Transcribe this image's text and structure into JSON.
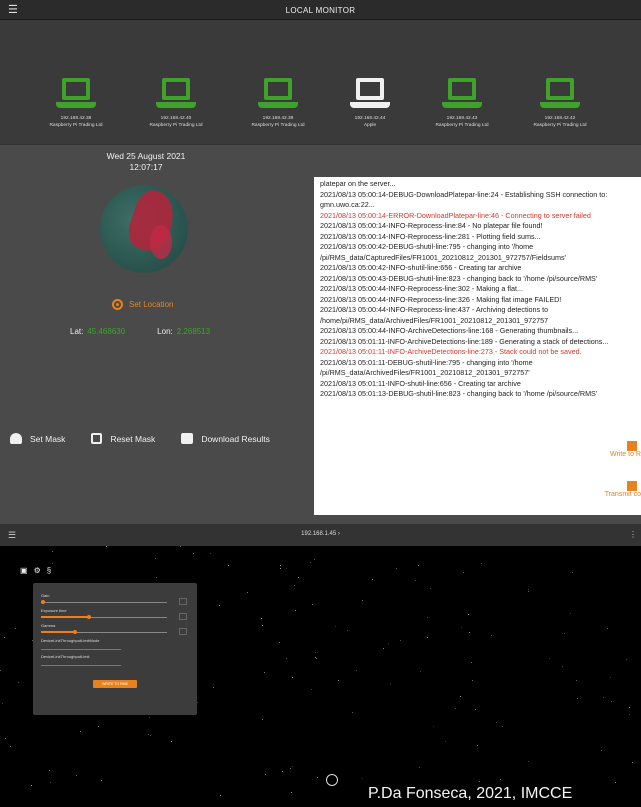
{
  "app": {
    "title": "LOCAL MONITOR"
  },
  "devices": [
    {
      "ip": "192.168.42.38",
      "vendor": "Raspberry Pi Trading Ltd",
      "color": "#3fa32b"
    },
    {
      "ip": "192.168.42.40",
      "vendor": "Raspberry Pi Trading Ltd",
      "color": "#3fa32b"
    },
    {
      "ip": "192.168.42.39",
      "vendor": "Raspberry Pi Trading Ltd",
      "color": "#3fa32b"
    },
    {
      "ip": "192.168.42.44",
      "vendor": "Apple",
      "color": "#f0f0f0"
    },
    {
      "ip": "192.168.42.43",
      "vendor": "Raspberry Pi Trading Ltd",
      "color": "#3fa32b"
    },
    {
      "ip": "192.168.42.42",
      "vendor": "Raspberry Pi Trading Ltd",
      "color": "#3fa32b"
    }
  ],
  "station": {
    "date": "Wed 25 August 2021",
    "time": "12:07:17",
    "set_location_label": "Set Location",
    "lat_label": "Lat:",
    "lat_value": "45.468630",
    "lon_label": "Lon:",
    "lon_value": "2.268513"
  },
  "actions": {
    "set_mask": "Set Mask",
    "reset_mask": "Reset Mask",
    "download_results": "Download Results"
  },
  "log": {
    "lines": [
      {
        "text": "platepar on the server...",
        "error": false
      },
      {
        "text": "2021/08/13 05:00:14-DEBUG-DownloadPlatepar-line:24 - Establishing SSH connection to: gmn.uwo.ca:22...",
        "error": false
      },
      {
        "text": "2021/08/13 05:00:14-ERROR-DownloadPlatepar-line:46 - Connecting to server failed",
        "error": true
      },
      {
        "text": "2021/08/13 05:00:14-INFO-Reprocess-line:84 - No platepar file found!",
        "error": false
      },
      {
        "text": "2021/08/13 05:00:14-INFO-Reprocess-line:281 - Plotting field sums...",
        "error": false
      },
      {
        "text": "2021/08/13 05:00:42-DEBUG-shutil-line:795 - changing into '/home /pi/RMS_data/CapturedFiles/FR1001_20210812_201301_972757/Fieldsums'",
        "error": false
      },
      {
        "text": "2021/08/13 05:00:42-INFO-shutil-line:656 - Creating tar archive",
        "error": false
      },
      {
        "text": "2021/08/13 05:00:43-DEBUG-shutil-line:823 - changing back to '/home /pi/source/RMS'",
        "error": false
      },
      {
        "text": "2021/08/13 05:00:44-INFO-Reprocess-line:302 - Making a flat...",
        "error": false
      },
      {
        "text": "2021/08/13 05:00:44-INFO-Reprocess-line:326 - Making flat image FAILED!",
        "error": false
      },
      {
        "text": "2021/08/13 05:00:44-INFO-Reprocess-line:437 - Archiving detections to /home/pi/RMS_data/ArchivedFiles/FR1001_20210812_201301_972757",
        "error": false
      },
      {
        "text": "2021/08/13 05:00:44-INFO-ArchiveDetections-line:168 - Generating thumbnails...",
        "error": false
      },
      {
        "text": "2021/08/13 05:01:11-INFO-ArchiveDetections-line:189 - Generating a stack of detections...",
        "error": false
      },
      {
        "text": "2021/08/13 05:01:11-INFO-ArchiveDetections-line:273 - Stack could not be saved.",
        "error": true
      },
      {
        "text": "2021/08/13 05:01:11-DEBUG-shutil-line:795 - changing into '/home /pi/RMS_data/ArchivedFiles/FR1001_20210812_201301_972757'",
        "error": false
      },
      {
        "text": "2021/08/13 05:01:11-INFO-shutil-line:656 - Creating tar archive",
        "error": false
      },
      {
        "text": "2021/08/13 05:01:13-DEBUG-shutil-line:823 - changing back to '/home /pi/source/RMS'",
        "error": false
      }
    ],
    "write_label": "Write to R",
    "transmit_label": "Transmit co"
  },
  "camera": {
    "ip": "192.168.1.45",
    "settings": {
      "gain_label": "Gain",
      "exposure_label": "Exposure time",
      "gamma_label": "Gamma",
      "throughput_limit_label": "DeviceLinkThroughputLimitMode",
      "throughput_label": "DeviceLinkThroughputLimit",
      "gain_value": 0.0,
      "exposure_value": 0.38,
      "gamma_value": 0.27,
      "save_label": "WRITE TO RMS"
    }
  },
  "credit": "P.Da Fonseca, 2021, IMCCE"
}
